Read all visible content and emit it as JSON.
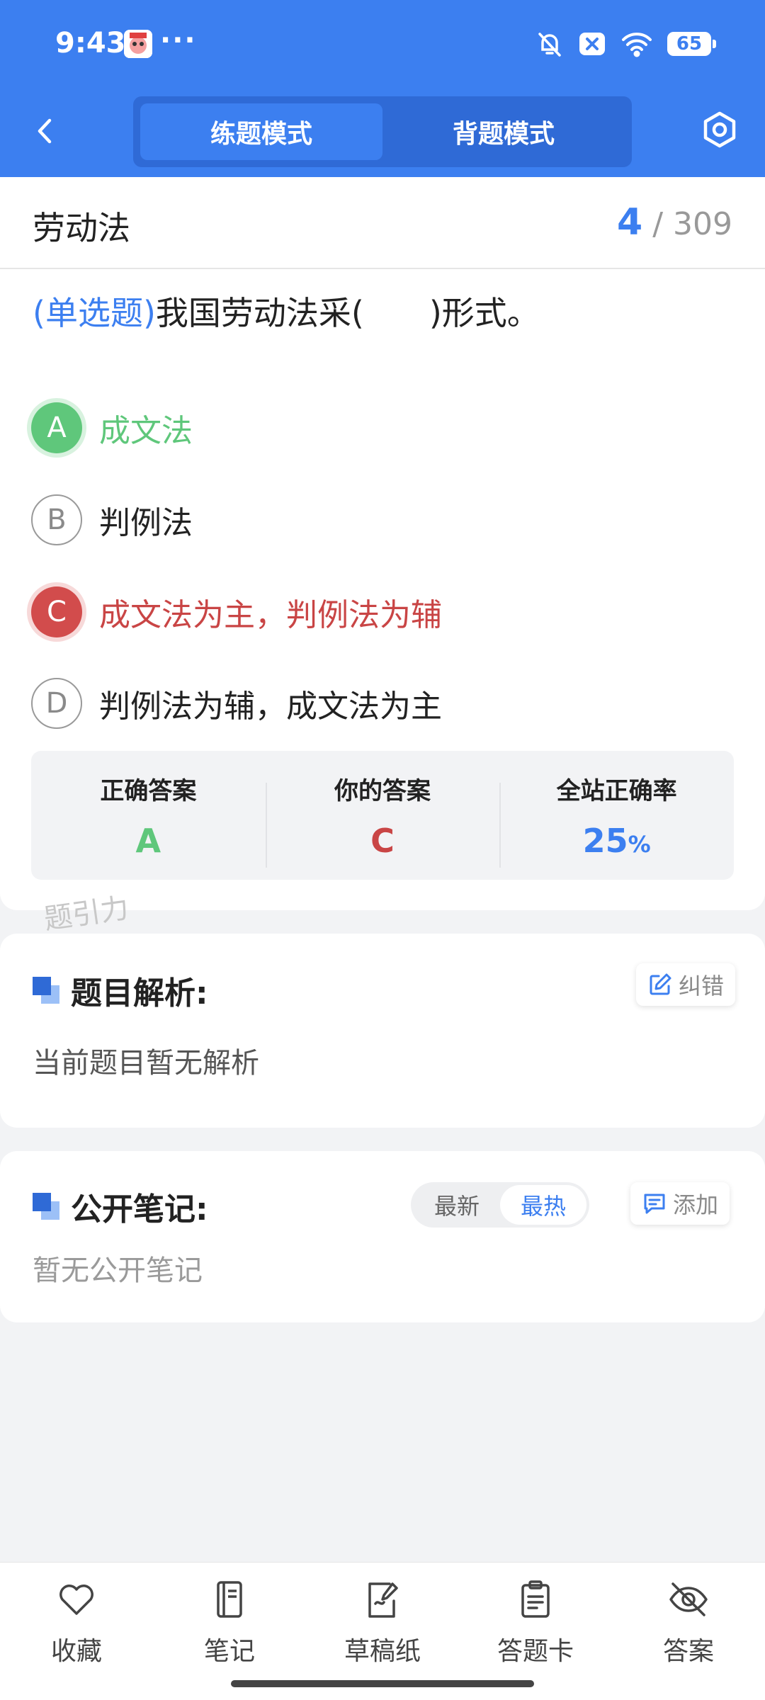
{
  "status_bar": {
    "time": "9:43",
    "more": "···",
    "battery": "65"
  },
  "header": {
    "tabs": [
      {
        "label": "练题模式",
        "active": true
      },
      {
        "label": "背题模式",
        "active": false
      }
    ]
  },
  "question": {
    "subject": "劳动法",
    "current": "4",
    "total": "/ 309",
    "type_label": "(单选题)",
    "text": "我国劳动法采(　　)形式。",
    "options": [
      {
        "letter": "A",
        "text": "成文法",
        "state": "correct"
      },
      {
        "letter": "B",
        "text": "判例法",
        "state": "normal"
      },
      {
        "letter": "C",
        "text": "成文法为主，判例法为辅",
        "state": "wrong"
      },
      {
        "letter": "D",
        "text": "判例法为辅，成文法为主",
        "state": "normal"
      }
    ],
    "result": {
      "correct_label": "正确答案",
      "correct_value": "A",
      "yours_label": "你的答案",
      "yours_value": "C",
      "rate_label": "全站正确率",
      "rate_value": "25",
      "rate_unit": "%"
    }
  },
  "watermark": "题引力",
  "analysis": {
    "title": "题目解析:",
    "report_label": "纠错",
    "content": "当前题目暂无解析"
  },
  "notes": {
    "title": "公开笔记:",
    "sort_options": [
      "最新",
      "最热"
    ],
    "sort_active": "最热",
    "add_label": "添加",
    "empty_text": "暂无公开笔记"
  },
  "bottom_nav": [
    {
      "label": "收藏",
      "icon": "heart-icon"
    },
    {
      "label": "笔记",
      "icon": "notebook-icon"
    },
    {
      "label": "草稿纸",
      "icon": "draft-paper-icon"
    },
    {
      "label": "答题卡",
      "icon": "answer-card-icon"
    },
    {
      "label": "答案",
      "icon": "eye-off-icon"
    }
  ],
  "colors": {
    "primary": "#3c7ff0",
    "correct": "#5fc77b",
    "wrong": "#c94545"
  }
}
